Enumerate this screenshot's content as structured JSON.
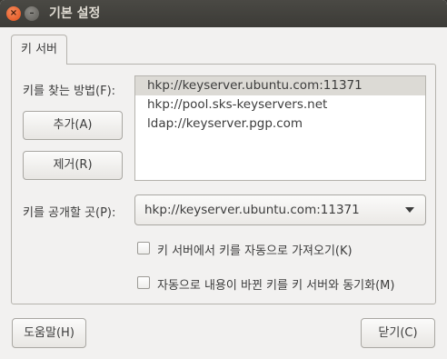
{
  "window": {
    "title": "기본 설정"
  },
  "tab": {
    "label": "키 서버"
  },
  "keyserver_section": {
    "find_label": "키를 찾는 방법(F):",
    "add_button": "추가(A)",
    "remove_button": "제거(R)",
    "servers": [
      "hkp://keyserver.ubuntu.com:11371",
      "hkp://pool.sks-keyservers.net",
      "ldap://keyserver.pgp.com"
    ],
    "selected_index": 0,
    "publish_label": "키를 공개할 곳(P):",
    "publish_value": "hkp://keyserver.ubuntu.com:11371",
    "auto_retrieve_label": "키 서버에서 키를 자동으로 가져오기(K)",
    "auto_retrieve_checked": false,
    "auto_sync_label": "자동으로 내용이 바뀐 키를 키 서버와 동기화(M)",
    "auto_sync_checked": false
  },
  "footer": {
    "help_button": "도움말(H)",
    "close_button": "닫기(C)"
  },
  "colors": {
    "titlebar": "#3c3b37",
    "window_bg": "#f2f1f0",
    "close_button": "#e1501a",
    "selection": "#dcdad5"
  },
  "icons": {
    "close": "close-icon",
    "minimize": "minimize-icon",
    "dropdown": "chevron-down-icon"
  }
}
